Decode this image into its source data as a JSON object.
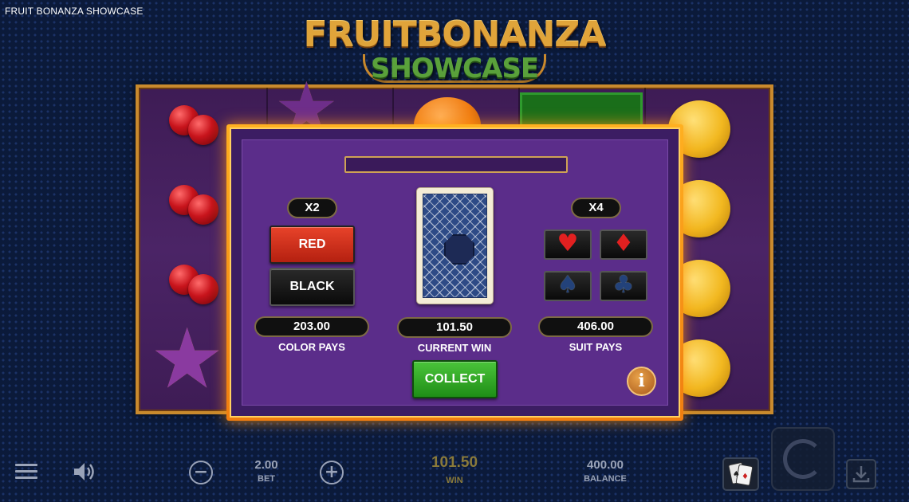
{
  "window": {
    "title": "FRUIT BONANZA SHOWCASE"
  },
  "logo": {
    "line1": "FRUITBONANZA",
    "line2": "SHOWCASE"
  },
  "gamble": {
    "message": "",
    "color_multiplier": "X2",
    "suit_multiplier": "X4",
    "red_label": "RED",
    "black_label": "BLACK",
    "suits": [
      {
        "name": "hearts",
        "glyph": "♥"
      },
      {
        "name": "diamonds",
        "glyph": "♦"
      },
      {
        "name": "spades",
        "glyph": "♠"
      },
      {
        "name": "clubs",
        "glyph": "♣"
      }
    ],
    "color_pays_value": "203.00",
    "color_pays_label": "COLOR PAYS",
    "current_win_value": "101.50",
    "current_win_label": "CURRENT WIN",
    "suit_pays_value": "406.00",
    "suit_pays_label": "SUIT PAYS",
    "collect_label": "COLLECT",
    "info_label": "i"
  },
  "bottom_bar": {
    "bet_value": "2.00",
    "bet_label": "BET",
    "win_value": "101.50",
    "win_label": "WIN",
    "balance_value": "400.00",
    "balance_label": "BALANCE",
    "minus_glyph": "−",
    "plus_glyph": "+"
  },
  "colors": {
    "panel_border": "#f59a1a",
    "panel_bg": "#5b2d8a",
    "red_button": "#c8321c",
    "collect_button": "#2fa322",
    "win_value_color": "#e0b23a"
  }
}
